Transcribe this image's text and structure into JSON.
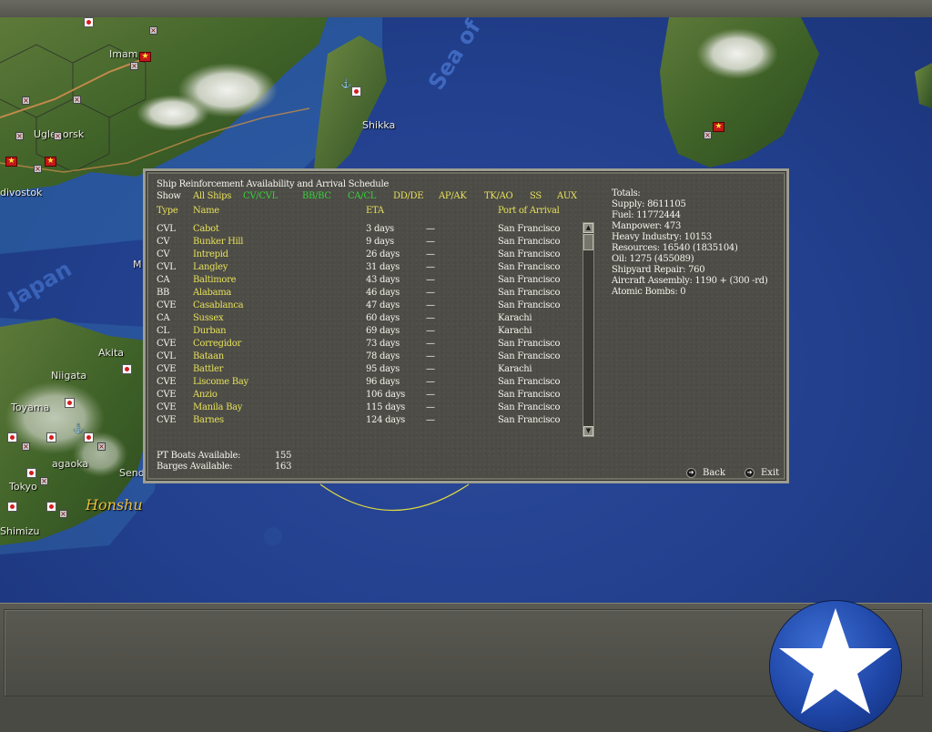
{
  "map": {
    "labels": {
      "imam": "Imam",
      "uglegorsk": "Uglegorsk",
      "vladivostok": "divostok",
      "shikka": "Shikka",
      "sea_of_okhotsk": "Sea of Okhotsk",
      "sea_of_japan": "Japan",
      "m": "M",
      "akita": "Akita",
      "niigata": "Niigata",
      "toyama": "Toyama",
      "nagaoka": "agaoka",
      "tokyo": "Tokyo",
      "sendai": "Send",
      "shimizu": "Shimizu",
      "honshu": "Honshu"
    }
  },
  "dialog": {
    "title": "Ship Reinforcement Availability and Arrival Schedule",
    "filters": {
      "show_label": "Show",
      "all_ships": "All Ships",
      "cv_cvl": "CV/CVL",
      "bb_bc": "BB/BC",
      "ca_cl": "CA/CL",
      "dd_de": "DD/DE",
      "ap_ak": "AP/AK",
      "tk_ao": "TK/AO",
      "ss": "SS",
      "aux": "AUX"
    },
    "columns": {
      "type": "Type",
      "name": "Name",
      "eta": "ETA",
      "port": "Port of Arrival"
    },
    "rows": [
      {
        "type": "CVL",
        "name": "Cabot",
        "eta": "3 days",
        "dash": "—",
        "port": "San Francisco"
      },
      {
        "type": "CV",
        "name": "Bunker Hill",
        "eta": "9 days",
        "dash": "—",
        "port": "San Francisco"
      },
      {
        "type": "CV",
        "name": "Intrepid",
        "eta": "26 days",
        "dash": "—",
        "port": "San Francisco"
      },
      {
        "type": "CVL",
        "name": "Langley",
        "eta": "31 days",
        "dash": "—",
        "port": "San Francisco"
      },
      {
        "type": "CA",
        "name": "Baltimore",
        "eta": "43 days",
        "dash": "—",
        "port": "San Francisco"
      },
      {
        "type": "BB",
        "name": "Alabama",
        "eta": "46 days",
        "dash": "—",
        "port": "San Francisco"
      },
      {
        "type": "CVE",
        "name": "Casablanca",
        "eta": "47 days",
        "dash": "—",
        "port": "San Francisco"
      },
      {
        "type": "CA",
        "name": "Sussex",
        "eta": "60 days",
        "dash": "—",
        "port": "Karachi"
      },
      {
        "type": "CL",
        "name": "Durban",
        "eta": "69 days",
        "dash": "—",
        "port": "Karachi"
      },
      {
        "type": "CVE",
        "name": "Corregidor",
        "eta": "73 days",
        "dash": "—",
        "port": "San Francisco"
      },
      {
        "type": "CVL",
        "name": "Bataan",
        "eta": "78 days",
        "dash": "—",
        "port": "San Francisco"
      },
      {
        "type": "CVE",
        "name": "Battler",
        "eta": "95 days",
        "dash": "—",
        "port": "Karachi"
      },
      {
        "type": "CVE",
        "name": "Liscome Bay",
        "eta": "96 days",
        "dash": "—",
        "port": "San Francisco"
      },
      {
        "type": "CVE",
        "name": "Anzio",
        "eta": "106 days",
        "dash": "—",
        "port": "San Francisco"
      },
      {
        "type": "CVE",
        "name": "Manila Bay",
        "eta": "115 days",
        "dash": "—",
        "port": "San Francisco"
      },
      {
        "type": "CVE",
        "name": "Barnes",
        "eta": "124 days",
        "dash": "—",
        "port": "San Francisco"
      }
    ],
    "totals": {
      "heading": "Totals:",
      "supply": "Supply: 8611105",
      "fuel": "Fuel: 11772444",
      "manpower": "Manpower: 473",
      "heavy_industry": "Heavy Industry: 10153",
      "resources": "Resources: 16540 (1835104)",
      "oil": "Oil: 1275 (455089)",
      "shipyard": "Shipyard Repair: 760",
      "aircraft": "Aircraft Assembly: 1190 + (300 -rd)",
      "atomic": "Atomic Bombs: 0"
    },
    "availability": {
      "pt_label": "PT Boats Available:",
      "pt_value": "155",
      "barges_label": "Barges Available:",
      "barges_value": "163"
    },
    "buttons": {
      "back": "Back",
      "exit": "Exit"
    }
  },
  "colors": {
    "ocean": "#22408e",
    "dialog_bg": "#4d4c46",
    "text_white": "#f4f4ec",
    "text_yellow": "#e6e05a",
    "text_green": "#36d23a"
  }
}
